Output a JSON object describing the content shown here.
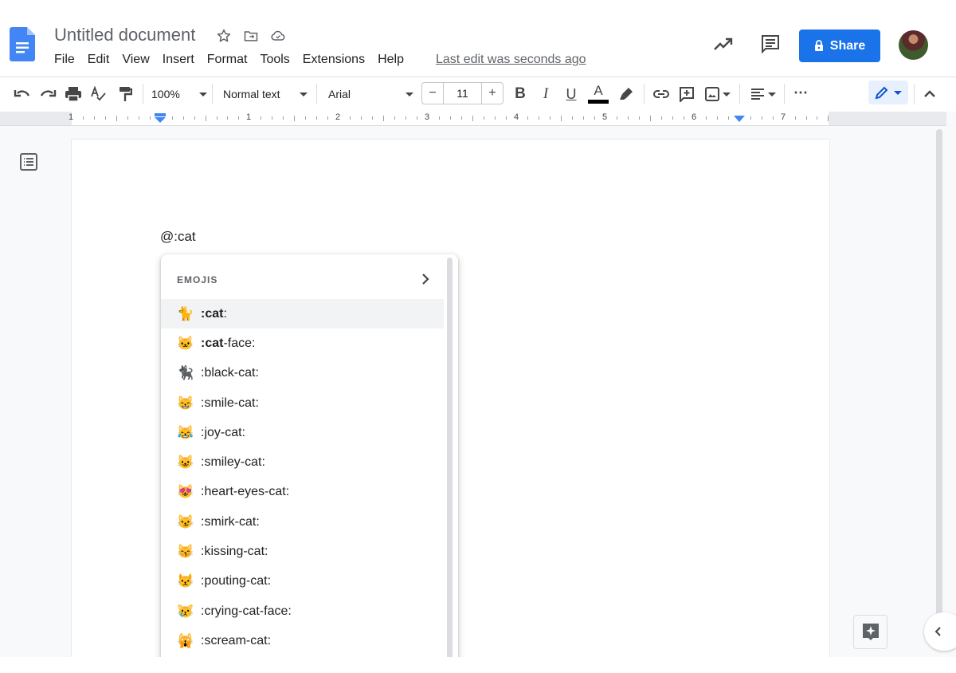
{
  "header": {
    "title": "Untitled document",
    "menu": [
      "File",
      "Edit",
      "View",
      "Insert",
      "Format",
      "Tools",
      "Extensions",
      "Help"
    ],
    "last_edit": "Last edit was seconds ago",
    "share_label": "Share",
    "brand_color": "#1a73e8"
  },
  "toolbar": {
    "zoom": "100%",
    "style": "Normal text",
    "font": "Arial",
    "font_size": "11",
    "minus": "−",
    "plus": "+",
    "more": "⋯"
  },
  "ruler": {
    "labels": [
      "1",
      "1",
      "2",
      "3",
      "4",
      "5",
      "6",
      "7"
    ]
  },
  "document": {
    "typed_text": "@:cat"
  },
  "emoji_popup": {
    "title": "EMOJIS",
    "items": [
      {
        "emoji": "🐈",
        "bold": ":cat",
        "rest": ":",
        "selected": true
      },
      {
        "emoji": "🐱",
        "bold": ":cat",
        "rest": "-face:"
      },
      {
        "emoji": "🐈‍⬛",
        "bold": "",
        "rest": ":black-cat:"
      },
      {
        "emoji": "😸",
        "bold": "",
        "rest": ":smile-cat:"
      },
      {
        "emoji": "😹",
        "bold": "",
        "rest": ":joy-cat:"
      },
      {
        "emoji": "😺",
        "bold": "",
        "rest": ":smiley-cat:"
      },
      {
        "emoji": "😻",
        "bold": "",
        "rest": ":heart-eyes-cat:"
      },
      {
        "emoji": "😼",
        "bold": "",
        "rest": ":smirk-cat:"
      },
      {
        "emoji": "😽",
        "bold": "",
        "rest": ":kissing-cat:"
      },
      {
        "emoji": "😾",
        "bold": "",
        "rest": ":pouting-cat:"
      },
      {
        "emoji": "😿",
        "bold": "",
        "rest": ":crying-cat-face:"
      },
      {
        "emoji": "🙀",
        "bold": "",
        "rest": ":scream-cat:"
      }
    ]
  }
}
